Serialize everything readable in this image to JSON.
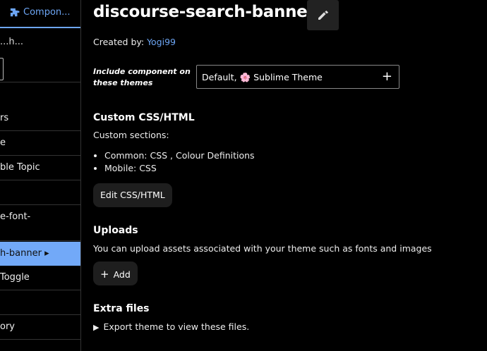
{
  "sidebar": {
    "tab_label": "Compon...",
    "truncated_text": "...h...",
    "items": [
      {
        "label": "rs"
      },
      {
        "label": "e"
      },
      {
        "label": "ble Topic"
      },
      {
        "label": ""
      },
      {
        "label": "e-font-"
      },
      {
        "label": "h-banner ▸"
      },
      {
        "label": "Toggle"
      },
      {
        "label": ""
      },
      {
        "label": "ory"
      }
    ]
  },
  "header": {
    "title": "discourse-search-banner",
    "edit_icon": "pencil-icon"
  },
  "created_by": {
    "prefix": "Created by: ",
    "author": "Yogi99"
  },
  "include": {
    "label_line1": "Include component on",
    "label_line2": "these themes",
    "value": "Default, 🌸 Sublime Theme",
    "add": "+"
  },
  "custom_css": {
    "heading": "Custom CSS/HTML",
    "sections_label": "Custom sections:",
    "items": [
      "Common: CSS , Colour Definitions",
      "Mobile: CSS"
    ],
    "edit_button": "Edit CSS/HTML"
  },
  "uploads": {
    "heading": "Uploads",
    "description": "You can upload assets associated with your theme such as fonts and images",
    "add_button": "Add"
  },
  "extra_files": {
    "heading": "Extra files",
    "summary": "Export theme to view these files."
  },
  "colors": {
    "accent": "#6da6f5",
    "active_bg": "#72a9f8"
  }
}
